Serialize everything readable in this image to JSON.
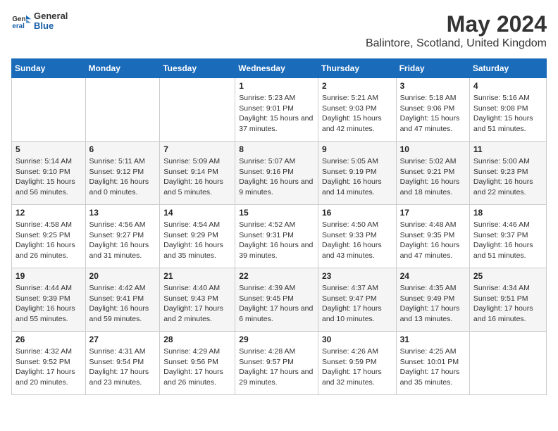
{
  "logo": {
    "general": "General",
    "blue": "Blue"
  },
  "header": {
    "title": "May 2024",
    "subtitle": "Balintore, Scotland, United Kingdom"
  },
  "weekdays": [
    "Sunday",
    "Monday",
    "Tuesday",
    "Wednesday",
    "Thursday",
    "Friday",
    "Saturday"
  ],
  "weeks": [
    [
      {
        "day": "",
        "info": ""
      },
      {
        "day": "",
        "info": ""
      },
      {
        "day": "",
        "info": ""
      },
      {
        "day": "1",
        "info": "Sunrise: 5:23 AM\nSunset: 9:01 PM\nDaylight: 15 hours and 37 minutes."
      },
      {
        "day": "2",
        "info": "Sunrise: 5:21 AM\nSunset: 9:03 PM\nDaylight: 15 hours and 42 minutes."
      },
      {
        "day": "3",
        "info": "Sunrise: 5:18 AM\nSunset: 9:06 PM\nDaylight: 15 hours and 47 minutes."
      },
      {
        "day": "4",
        "info": "Sunrise: 5:16 AM\nSunset: 9:08 PM\nDaylight: 15 hours and 51 minutes."
      }
    ],
    [
      {
        "day": "5",
        "info": "Sunrise: 5:14 AM\nSunset: 9:10 PM\nDaylight: 15 hours and 56 minutes."
      },
      {
        "day": "6",
        "info": "Sunrise: 5:11 AM\nSunset: 9:12 PM\nDaylight: 16 hours and 0 minutes."
      },
      {
        "day": "7",
        "info": "Sunrise: 5:09 AM\nSunset: 9:14 PM\nDaylight: 16 hours and 5 minutes."
      },
      {
        "day": "8",
        "info": "Sunrise: 5:07 AM\nSunset: 9:16 PM\nDaylight: 16 hours and 9 minutes."
      },
      {
        "day": "9",
        "info": "Sunrise: 5:05 AM\nSunset: 9:19 PM\nDaylight: 16 hours and 14 minutes."
      },
      {
        "day": "10",
        "info": "Sunrise: 5:02 AM\nSunset: 9:21 PM\nDaylight: 16 hours and 18 minutes."
      },
      {
        "day": "11",
        "info": "Sunrise: 5:00 AM\nSunset: 9:23 PM\nDaylight: 16 hours and 22 minutes."
      }
    ],
    [
      {
        "day": "12",
        "info": "Sunrise: 4:58 AM\nSunset: 9:25 PM\nDaylight: 16 hours and 26 minutes."
      },
      {
        "day": "13",
        "info": "Sunrise: 4:56 AM\nSunset: 9:27 PM\nDaylight: 16 hours and 31 minutes."
      },
      {
        "day": "14",
        "info": "Sunrise: 4:54 AM\nSunset: 9:29 PM\nDaylight: 16 hours and 35 minutes."
      },
      {
        "day": "15",
        "info": "Sunrise: 4:52 AM\nSunset: 9:31 PM\nDaylight: 16 hours and 39 minutes."
      },
      {
        "day": "16",
        "info": "Sunrise: 4:50 AM\nSunset: 9:33 PM\nDaylight: 16 hours and 43 minutes."
      },
      {
        "day": "17",
        "info": "Sunrise: 4:48 AM\nSunset: 9:35 PM\nDaylight: 16 hours and 47 minutes."
      },
      {
        "day": "18",
        "info": "Sunrise: 4:46 AM\nSunset: 9:37 PM\nDaylight: 16 hours and 51 minutes."
      }
    ],
    [
      {
        "day": "19",
        "info": "Sunrise: 4:44 AM\nSunset: 9:39 PM\nDaylight: 16 hours and 55 minutes."
      },
      {
        "day": "20",
        "info": "Sunrise: 4:42 AM\nSunset: 9:41 PM\nDaylight: 16 hours and 59 minutes."
      },
      {
        "day": "21",
        "info": "Sunrise: 4:40 AM\nSunset: 9:43 PM\nDaylight: 17 hours and 2 minutes."
      },
      {
        "day": "22",
        "info": "Sunrise: 4:39 AM\nSunset: 9:45 PM\nDaylight: 17 hours and 6 minutes."
      },
      {
        "day": "23",
        "info": "Sunrise: 4:37 AM\nSunset: 9:47 PM\nDaylight: 17 hours and 10 minutes."
      },
      {
        "day": "24",
        "info": "Sunrise: 4:35 AM\nSunset: 9:49 PM\nDaylight: 17 hours and 13 minutes."
      },
      {
        "day": "25",
        "info": "Sunrise: 4:34 AM\nSunset: 9:51 PM\nDaylight: 17 hours and 16 minutes."
      }
    ],
    [
      {
        "day": "26",
        "info": "Sunrise: 4:32 AM\nSunset: 9:52 PM\nDaylight: 17 hours and 20 minutes."
      },
      {
        "day": "27",
        "info": "Sunrise: 4:31 AM\nSunset: 9:54 PM\nDaylight: 17 hours and 23 minutes."
      },
      {
        "day": "28",
        "info": "Sunrise: 4:29 AM\nSunset: 9:56 PM\nDaylight: 17 hours and 26 minutes."
      },
      {
        "day": "29",
        "info": "Sunrise: 4:28 AM\nSunset: 9:57 PM\nDaylight: 17 hours and 29 minutes."
      },
      {
        "day": "30",
        "info": "Sunrise: 4:26 AM\nSunset: 9:59 PM\nDaylight: 17 hours and 32 minutes."
      },
      {
        "day": "31",
        "info": "Sunrise: 4:25 AM\nSunset: 10:01 PM\nDaylight: 17 hours and 35 minutes."
      },
      {
        "day": "",
        "info": ""
      }
    ]
  ]
}
